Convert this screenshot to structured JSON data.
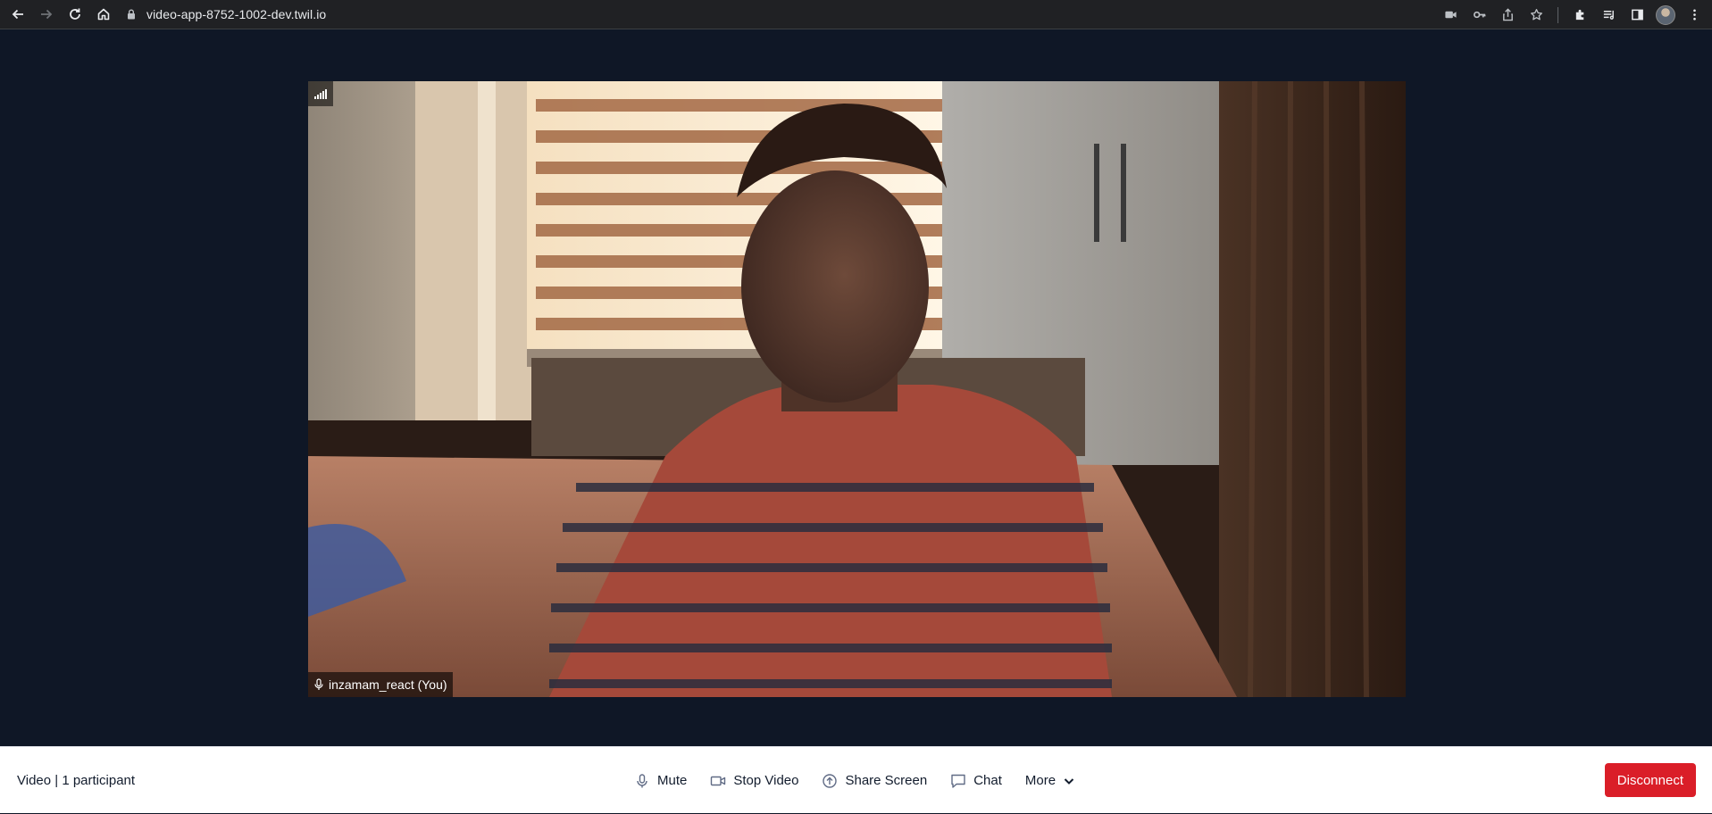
{
  "browser": {
    "url": "video-app-8752-1002-dev.twil.io"
  },
  "video": {
    "participant_name": "inzamam_react (You)"
  },
  "menubar": {
    "room_info": "Video | 1 participant",
    "controls": {
      "mute_label": "Mute",
      "stop_video_label": "Stop Video",
      "share_screen_label": "Share Screen",
      "chat_label": "Chat",
      "more_label": "More"
    },
    "disconnect_label": "Disconnect"
  },
  "colors": {
    "stage_background": "#0f1726",
    "disconnect": "#da1e28",
    "menubar_background": "#ffffff"
  },
  "icons": {
    "back": "back-arrow-icon",
    "forward": "forward-arrow-icon",
    "reload": "reload-icon",
    "home": "home-icon",
    "lock": "lock-icon",
    "camera_indicator": "camera-icon",
    "key": "key-icon",
    "share": "share-icon",
    "bookmark": "star-icon",
    "extensions": "puzzle-icon",
    "reading_list": "reading-list-icon",
    "side_panel": "side-panel-icon",
    "menu": "kebab-menu-icon",
    "network_quality": "signal-bars-icon",
    "microphone": "microphone-icon",
    "video": "video-camera-icon",
    "share_screen": "share-screen-icon",
    "chat": "chat-bubble-icon",
    "chevron": "chevron-down-icon"
  }
}
